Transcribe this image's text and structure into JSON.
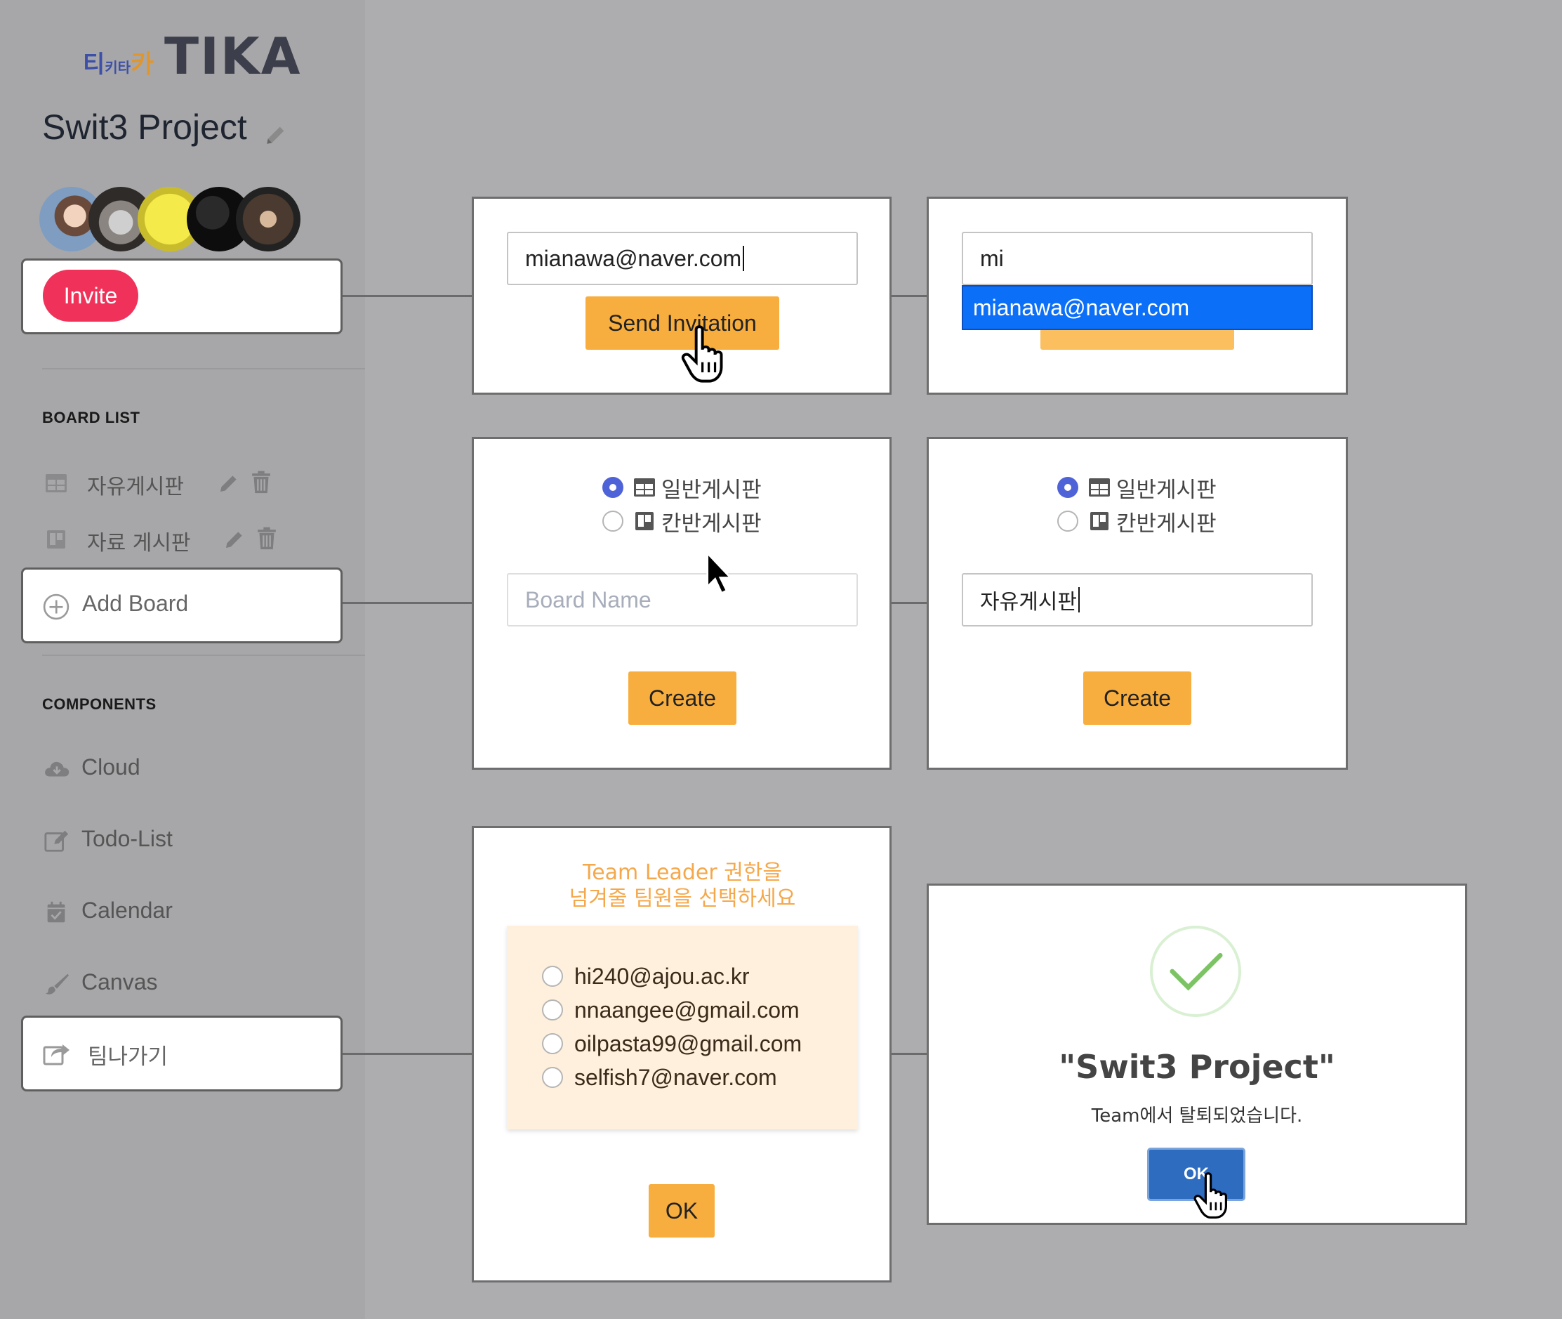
{
  "sidebar": {
    "logo_korean": [
      "티",
      "키타",
      "카"
    ],
    "logo_text": "TIKA",
    "project_title": "Swit3 Project",
    "invite_label": "Invite",
    "board_list_heading": "BOARD LIST",
    "boards": [
      {
        "label": "자유게시판",
        "icon": "table-icon"
      },
      {
        "label": "자료 게시판",
        "icon": "kanban-icon"
      }
    ],
    "add_board_label": "Add Board",
    "components_heading": "COMPONENTS",
    "components": [
      {
        "label": "Cloud",
        "icon": "cloud-icon"
      },
      {
        "label": "Todo-List",
        "icon": "edit-icon"
      },
      {
        "label": "Calendar",
        "icon": "calendar-icon"
      },
      {
        "label": "Canvas",
        "icon": "brush-icon"
      }
    ],
    "leave_label": "팀나가기"
  },
  "invite_panel": {
    "email_value": "mianawa@naver.com",
    "send_label": "Send Invitation"
  },
  "autocomplete_panel": {
    "typed_value": "mi",
    "suggestion": "mianawa@naver.com"
  },
  "create_board_panel": {
    "options": [
      "일반게시판",
      "칸반게시판"
    ],
    "selected_index": 0,
    "name_placeholder": "Board Name",
    "create_label": "Create"
  },
  "create_board_filled_panel": {
    "options": [
      "일반게시판",
      "칸반게시판"
    ],
    "selected_index": 0,
    "name_value": "자유게시판",
    "create_label": "Create"
  },
  "leader_panel": {
    "title_line1": "Team Leader 권한을",
    "title_line2": "넘겨줄 팀원을 선택하세요",
    "members": [
      "hi240@ajou.ac.kr",
      "nnaangee@gmail.com",
      "oilpasta99@gmail.com",
      "selfish7@naver.com"
    ],
    "ok_label": "OK"
  },
  "leave_success_panel": {
    "title": "\"Swit3 Project\"",
    "message": "Team에서 탈퇴되었습니다.",
    "ok_label": "OK"
  },
  "colors": {
    "invite": "#f0325a",
    "accent_orange": "#f8ae3e",
    "radio_selected": "#4f63d8",
    "suggestion_blue": "#0b6ff8",
    "ok_blue": "#2e6cc0",
    "success_green": "#7cc463"
  }
}
